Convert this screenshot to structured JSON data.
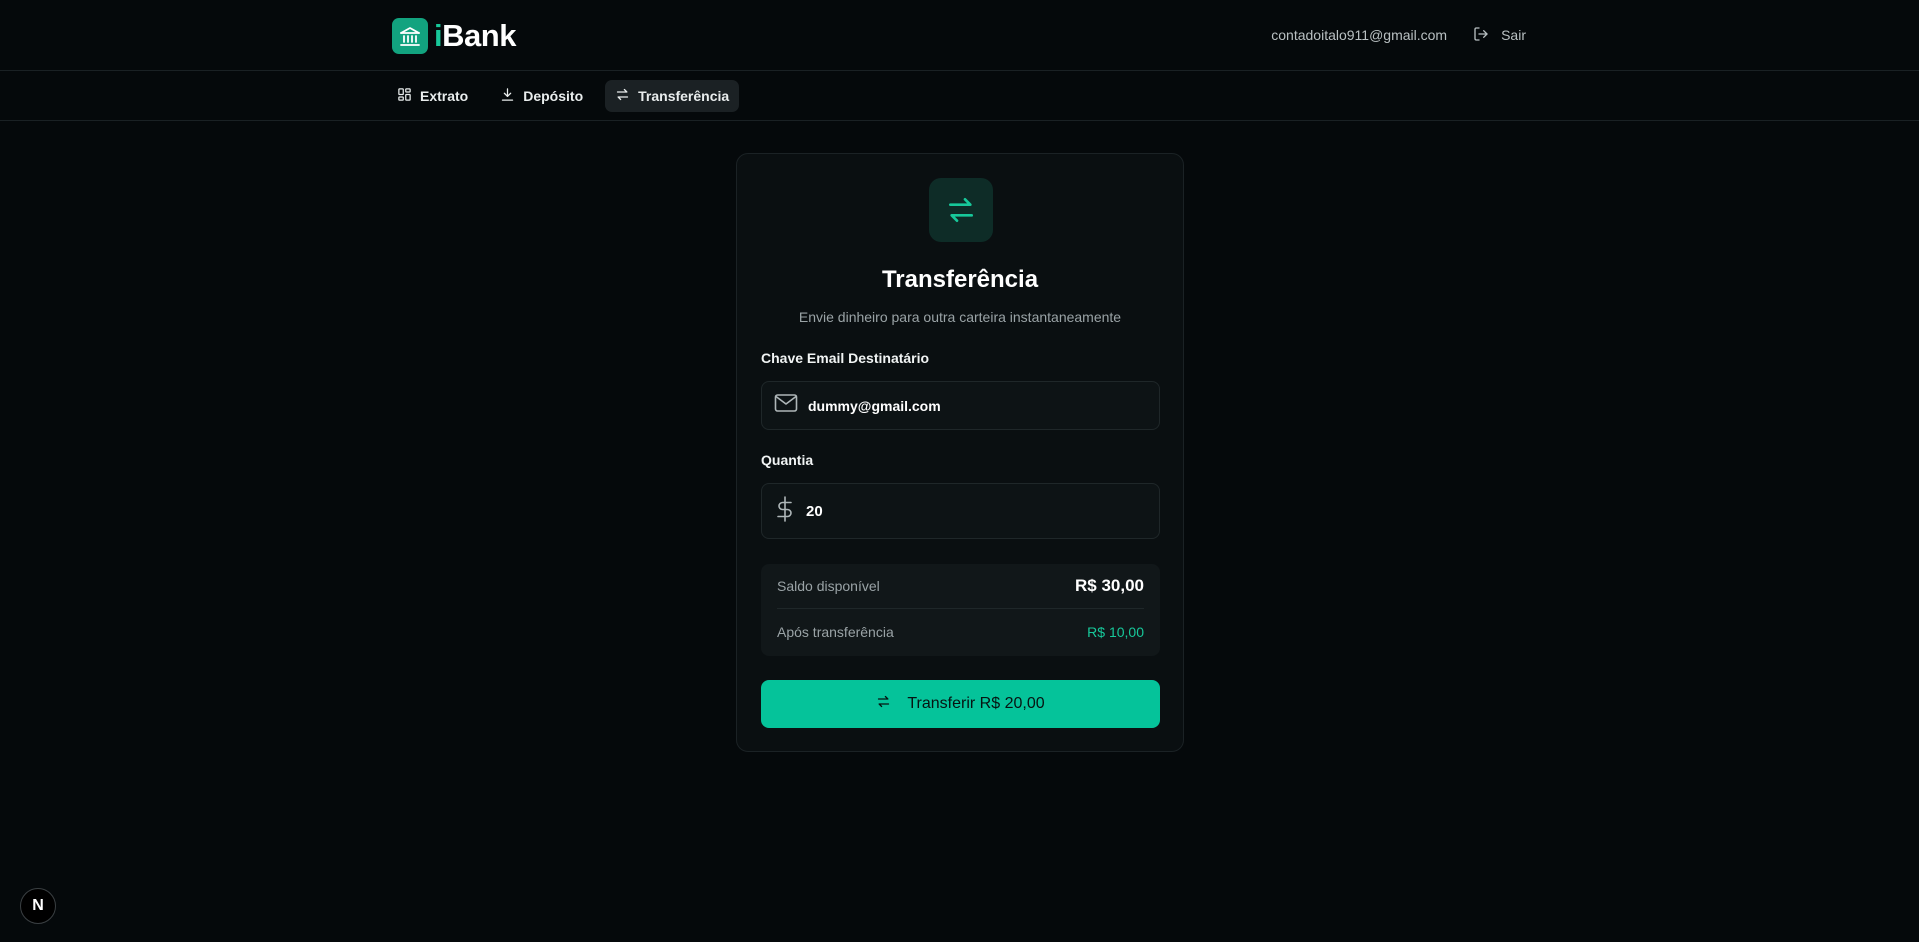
{
  "brand": {
    "name_accent": "i",
    "name_rest": "Bank",
    "logo_icon": "bank-building-icon",
    "accent_color": "#17c89a"
  },
  "header": {
    "user_email": "contadoitalo911@gmail.com",
    "logout_label": "Sair",
    "logout_icon": "logout-icon"
  },
  "nav": {
    "tabs": [
      {
        "label": "Extrato",
        "icon": "dashboard-grid-icon",
        "active": false
      },
      {
        "label": "Depósito",
        "icon": "download-icon",
        "active": false
      },
      {
        "label": "Transferência",
        "icon": "transfer-arrows-icon",
        "active": true
      }
    ]
  },
  "transfer": {
    "title": "Transferência",
    "subtitle": "Envie dinheiro para outra carteira instantaneamente",
    "email_label": "Chave Email Destinatário",
    "email_value": "dummy@gmail.com",
    "amount_label": "Quantia",
    "amount_value": "20",
    "balance_label": "Saldo disponível",
    "balance_value": "R$ 30,00",
    "after_label": "Após transferência",
    "after_value": "R$ 10,00",
    "submit_label": "Transferir R$ 20,00"
  },
  "dev_badge": {
    "label": "N"
  }
}
